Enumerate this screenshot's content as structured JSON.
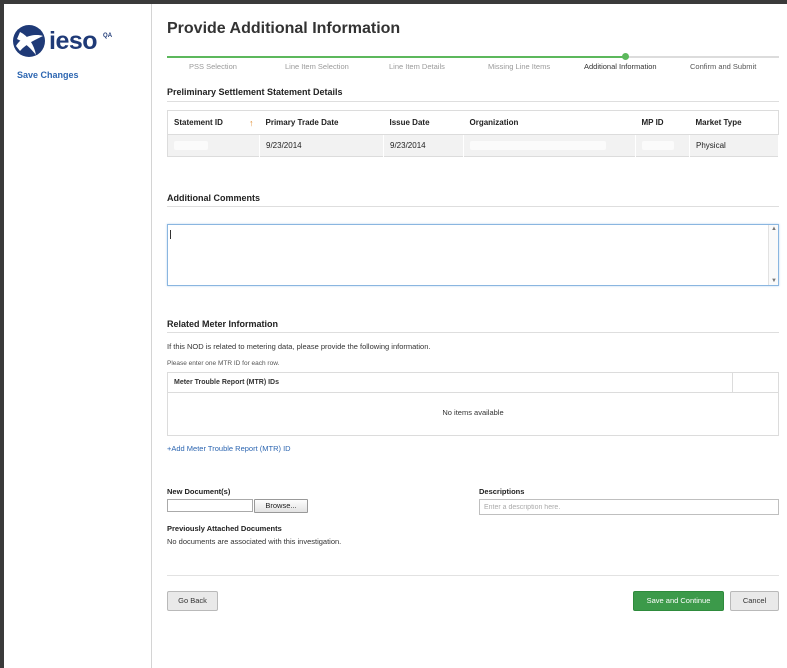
{
  "sidebar": {
    "logo_text": "ieso",
    "env_badge": "QA",
    "save_changes": "Save Changes"
  },
  "page_title": "Provide Additional Information",
  "steps": [
    {
      "label": "PSS Selection",
      "state": "complete"
    },
    {
      "label": "Line Item Selection",
      "state": "complete"
    },
    {
      "label": "Line Item Details",
      "state": "complete"
    },
    {
      "label": "Missing Line Items",
      "state": "complete"
    },
    {
      "label": "Additional Information",
      "state": "current"
    },
    {
      "label": "Confirm and Submit",
      "state": "upcoming"
    }
  ],
  "pss": {
    "title": "Preliminary Settlement Statement Details",
    "columns": [
      "Statement ID",
      "Primary Trade Date",
      "Issue Date",
      "Organization",
      "MP ID",
      "Market Type"
    ],
    "row": {
      "statement_id": "",
      "primary_trade_date": "9/23/2014",
      "issue_date": "9/23/2014",
      "organization": "",
      "mp_id": "",
      "market_type": "Physical"
    }
  },
  "comments": {
    "title": "Additional Comments",
    "value": ""
  },
  "meter": {
    "title": "Related Meter Information",
    "intro": "If this NOD is related to metering data, please provide the following information.",
    "hint": "Please enter one MTR ID for each row.",
    "column": "Meter Trouble Report (MTR) IDs",
    "empty": "No items available",
    "add_link": "+Add Meter Trouble Report (MTR) ID"
  },
  "documents": {
    "new_label": "New Document(s)",
    "browse": "Browse...",
    "desc_label": "Descriptions",
    "desc_placeholder": "Enter a description here.",
    "prev_label": "Previously Attached Documents",
    "prev_empty": "No documents are associated with this investigation."
  },
  "actions": {
    "back": "Go Back",
    "save": "Save and Continue",
    "cancel": "Cancel"
  },
  "colors": {
    "brand": "#1f3a77",
    "link": "#2d66b1",
    "progress": "#5cb85c",
    "primary_button": "#3c9a4a"
  }
}
